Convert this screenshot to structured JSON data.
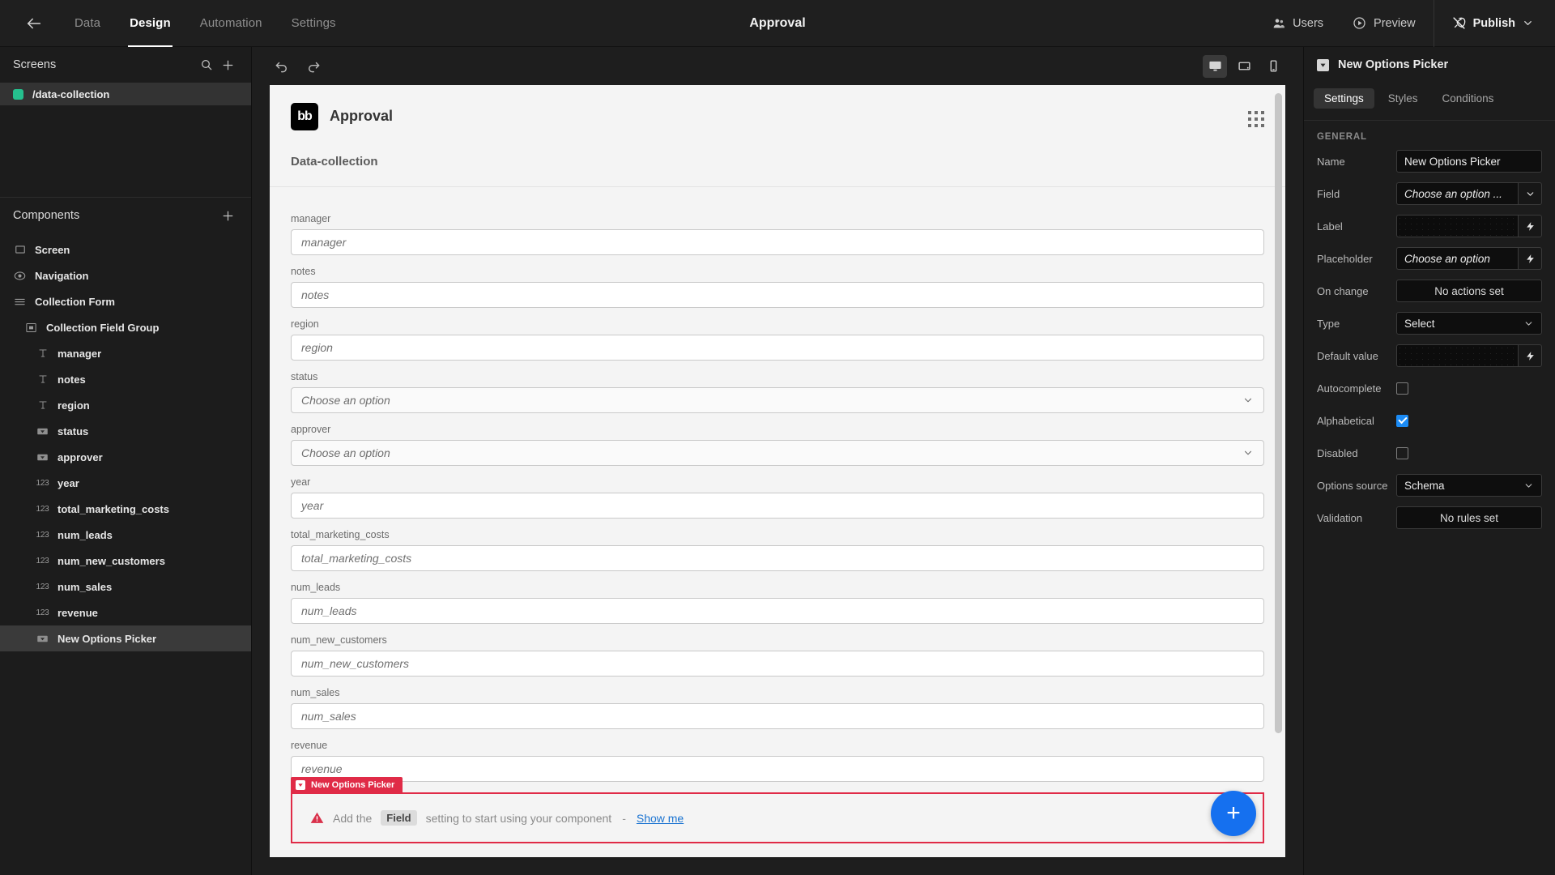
{
  "topbar": {
    "back_icon": "arrow-left-icon",
    "tabs": [
      {
        "label": "Data",
        "active": false
      },
      {
        "label": "Design",
        "active": true
      },
      {
        "label": "Automation",
        "active": false
      },
      {
        "label": "Settings",
        "active": false
      }
    ],
    "title": "Approval",
    "users_label": "Users",
    "preview_label": "Preview",
    "publish_label": "Publish"
  },
  "sidebar": {
    "screens_title": "Screens",
    "screens": [
      {
        "label": "/data-collection",
        "color": "#25C08E",
        "selected": true
      }
    ],
    "components_title": "Components",
    "components": [
      {
        "label": "Screen",
        "icon": "screen-icon",
        "indent": 0,
        "selected": false
      },
      {
        "label": "Navigation",
        "icon": "navigation-icon",
        "indent": 0,
        "selected": false
      },
      {
        "label": "Collection Form",
        "icon": "form-icon",
        "indent": 0,
        "selected": false
      },
      {
        "label": "Collection Field Group",
        "icon": "field-group-icon",
        "indent": 1,
        "selected": false
      },
      {
        "label": "manager",
        "icon": "text-icon",
        "indent": 2,
        "selected": false
      },
      {
        "label": "notes",
        "icon": "text-icon",
        "indent": 2,
        "selected": false
      },
      {
        "label": "region",
        "icon": "text-icon",
        "indent": 2,
        "selected": false
      },
      {
        "label": "status",
        "icon": "dropdown-icon",
        "indent": 2,
        "selected": false
      },
      {
        "label": "approver",
        "icon": "dropdown-icon",
        "indent": 2,
        "selected": false
      },
      {
        "label": "year",
        "icon": "number-icon",
        "indent": 2,
        "selected": false
      },
      {
        "label": "total_marketing_costs",
        "icon": "number-icon",
        "indent": 2,
        "selected": false
      },
      {
        "label": "num_leads",
        "icon": "number-icon",
        "indent": 2,
        "selected": false
      },
      {
        "label": "num_new_customers",
        "icon": "number-icon",
        "indent": 2,
        "selected": false
      },
      {
        "label": "num_sales",
        "icon": "number-icon",
        "indent": 2,
        "selected": false
      },
      {
        "label": "revenue",
        "icon": "number-icon",
        "indent": 2,
        "selected": false
      },
      {
        "label": "New Options Picker",
        "icon": "dropdown-icon",
        "indent": 2,
        "selected": true
      }
    ]
  },
  "canvas": {
    "undo_icon": "undo-icon",
    "redo_icon": "redo-icon",
    "devices": [
      {
        "name": "desktop-icon",
        "active": true
      },
      {
        "name": "tablet-icon",
        "active": false
      },
      {
        "name": "mobile-icon",
        "active": false
      }
    ],
    "app_logo_text": "bb",
    "app_header_title": "Approval",
    "section_title": "Data-collection",
    "fields": [
      {
        "label": "manager",
        "placeholder": "manager",
        "type": "text"
      },
      {
        "label": "notes",
        "placeholder": "notes",
        "type": "text"
      },
      {
        "label": "region",
        "placeholder": "region",
        "type": "text"
      },
      {
        "label": "status",
        "placeholder": "Choose an option",
        "type": "select"
      },
      {
        "label": "approver",
        "placeholder": "Choose an option",
        "type": "select"
      },
      {
        "label": "year",
        "placeholder": "year",
        "type": "text"
      },
      {
        "label": "total_marketing_costs",
        "placeholder": "total_marketing_costs",
        "type": "text"
      },
      {
        "label": "num_leads",
        "placeholder": "num_leads",
        "type": "text"
      },
      {
        "label": "num_new_customers",
        "placeholder": "num_new_customers",
        "type": "text"
      },
      {
        "label": "num_sales",
        "placeholder": "num_sales",
        "type": "text"
      },
      {
        "label": "revenue",
        "placeholder": "revenue",
        "type": "text"
      }
    ],
    "selection_tag": "New Options Picker",
    "alert": {
      "prefix": "Add the",
      "chip": "Field",
      "suffix": "setting to start using your component",
      "dash": "-",
      "link": "Show me"
    },
    "fab_label": "+"
  },
  "rightpanel": {
    "header_title": "New Options Picker",
    "tabs": [
      {
        "label": "Settings",
        "active": true
      },
      {
        "label": "Styles",
        "active": false
      },
      {
        "label": "Conditions",
        "active": false
      }
    ],
    "section": "GENERAL",
    "rows": {
      "name_label": "Name",
      "name_value": "New Options Picker",
      "field_label": "Field",
      "field_value": "Choose an option ...",
      "label_label": "Label",
      "label_value": "",
      "placeholder_label": "Placeholder",
      "placeholder_value": "Choose an option",
      "onchange_label": "On change",
      "onchange_value": "No actions set",
      "type_label": "Type",
      "type_value": "Select",
      "default_label": "Default value",
      "default_value": "",
      "autocomplete_label": "Autocomplete",
      "autocomplete_checked": false,
      "alphabetical_label": "Alphabetical",
      "alphabetical_checked": true,
      "disabled_label": "Disabled",
      "disabled_checked": false,
      "options_source_label": "Options source",
      "options_source_value": "Schema",
      "validation_label": "Validation",
      "validation_value": "No rules set"
    }
  },
  "colors": {
    "accent_blue": "#1570EF",
    "error_red": "#E02B47",
    "screen_green": "#25C08E",
    "checkbox_blue": "#1B8BF5"
  }
}
